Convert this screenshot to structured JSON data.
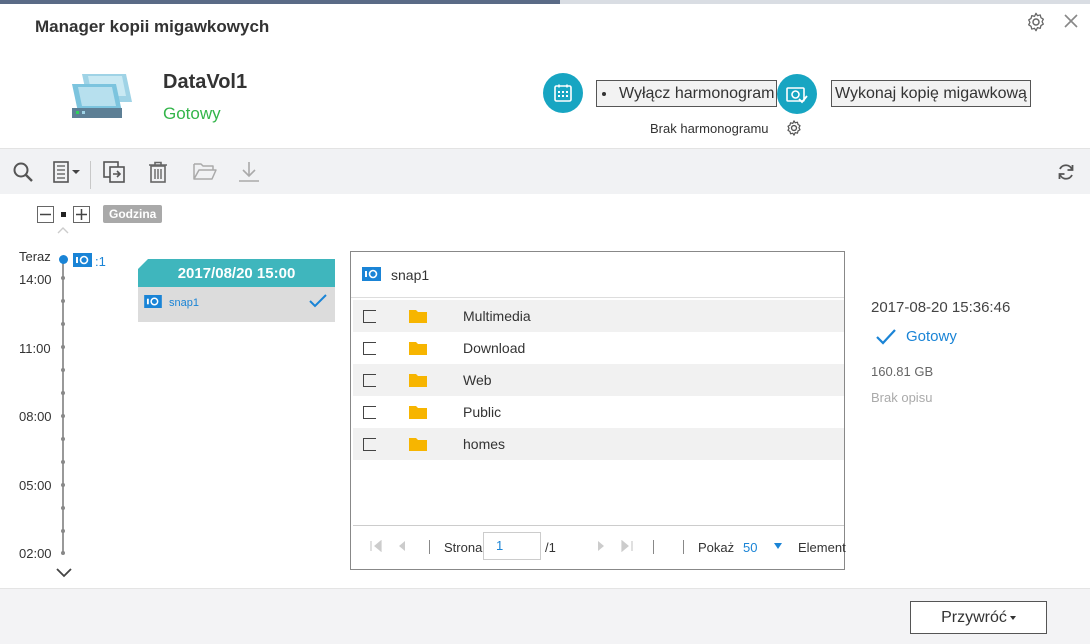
{
  "window": {
    "title": "Manager kopii migawkowych",
    "settings_icon": "gear-icon",
    "close_icon": "close-icon"
  },
  "volume": {
    "name": "DataVol1",
    "status": "Gotowy",
    "status_color": "#33b54a",
    "icon": "storage-volume-icon"
  },
  "actions": {
    "schedule_button_label": "Wyłącz harmonogram",
    "snapshot_button_label": "Wykonaj kopię migawkową",
    "schedule_status": "Brak harmonogramu",
    "accent_color": "#17a5c2"
  },
  "toolbar": {
    "icons": [
      "search-icon",
      "view-options-icon",
      "clone-icon",
      "delete-icon",
      "open-folder-icon",
      "download-icon",
      "refresh-icon"
    ]
  },
  "timeline": {
    "zoom_label": "Godzina",
    "now_label": "Teraz",
    "time_labels": [
      "14:00",
      "11:00",
      "08:00",
      "05:00",
      "02:00"
    ],
    "snapshot_count": ":1"
  },
  "snapshot_card": {
    "datetime": "2017/08/20 15:00",
    "name": "snap1"
  },
  "browser": {
    "snapshot_name": "snap1",
    "folders": [
      {
        "name": "Multimedia"
      },
      {
        "name": "Download"
      },
      {
        "name": "Web"
      },
      {
        "name": "Public"
      },
      {
        "name": "homes"
      }
    ],
    "pager": {
      "page_label": "Strona",
      "page_value": "1",
      "page_total": "/1",
      "show_label": "Pokaż",
      "show_value": "50",
      "items_label": "Element"
    }
  },
  "details": {
    "datetime": "2017-08-20 15:36:46",
    "status": "Gotowy",
    "size": "160.81 GB",
    "description": "Brak opisu"
  },
  "footer": {
    "restore_label": "Przywróć"
  }
}
